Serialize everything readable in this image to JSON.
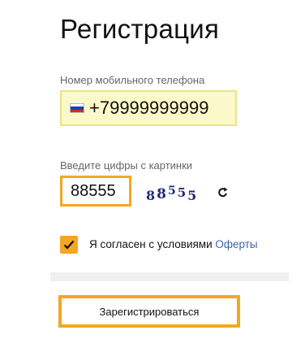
{
  "form": {
    "title": "Регистрация",
    "phone_label": "Номер мобильного телефона",
    "phone_value": "+79999999999",
    "country_flag_icon": "russia-flag-icon",
    "captcha_label": "Введите цифры с картинки",
    "captcha_value": "88555",
    "captcha_image_digits": [
      "8",
      "8",
      "5",
      "5",
      "5"
    ],
    "refresh_icon": "refresh-icon",
    "agree_checked": true,
    "agree_text": "Я согласен с условиями",
    "agree_link": "Оферты",
    "submit_label": "Зарегистрироваться"
  },
  "colors": {
    "accent": "#f5a623",
    "phone_field_bg": "#fbf8c9",
    "link": "#3a66b0",
    "captcha_digits": "#1f2a7a",
    "label": "#666666"
  }
}
